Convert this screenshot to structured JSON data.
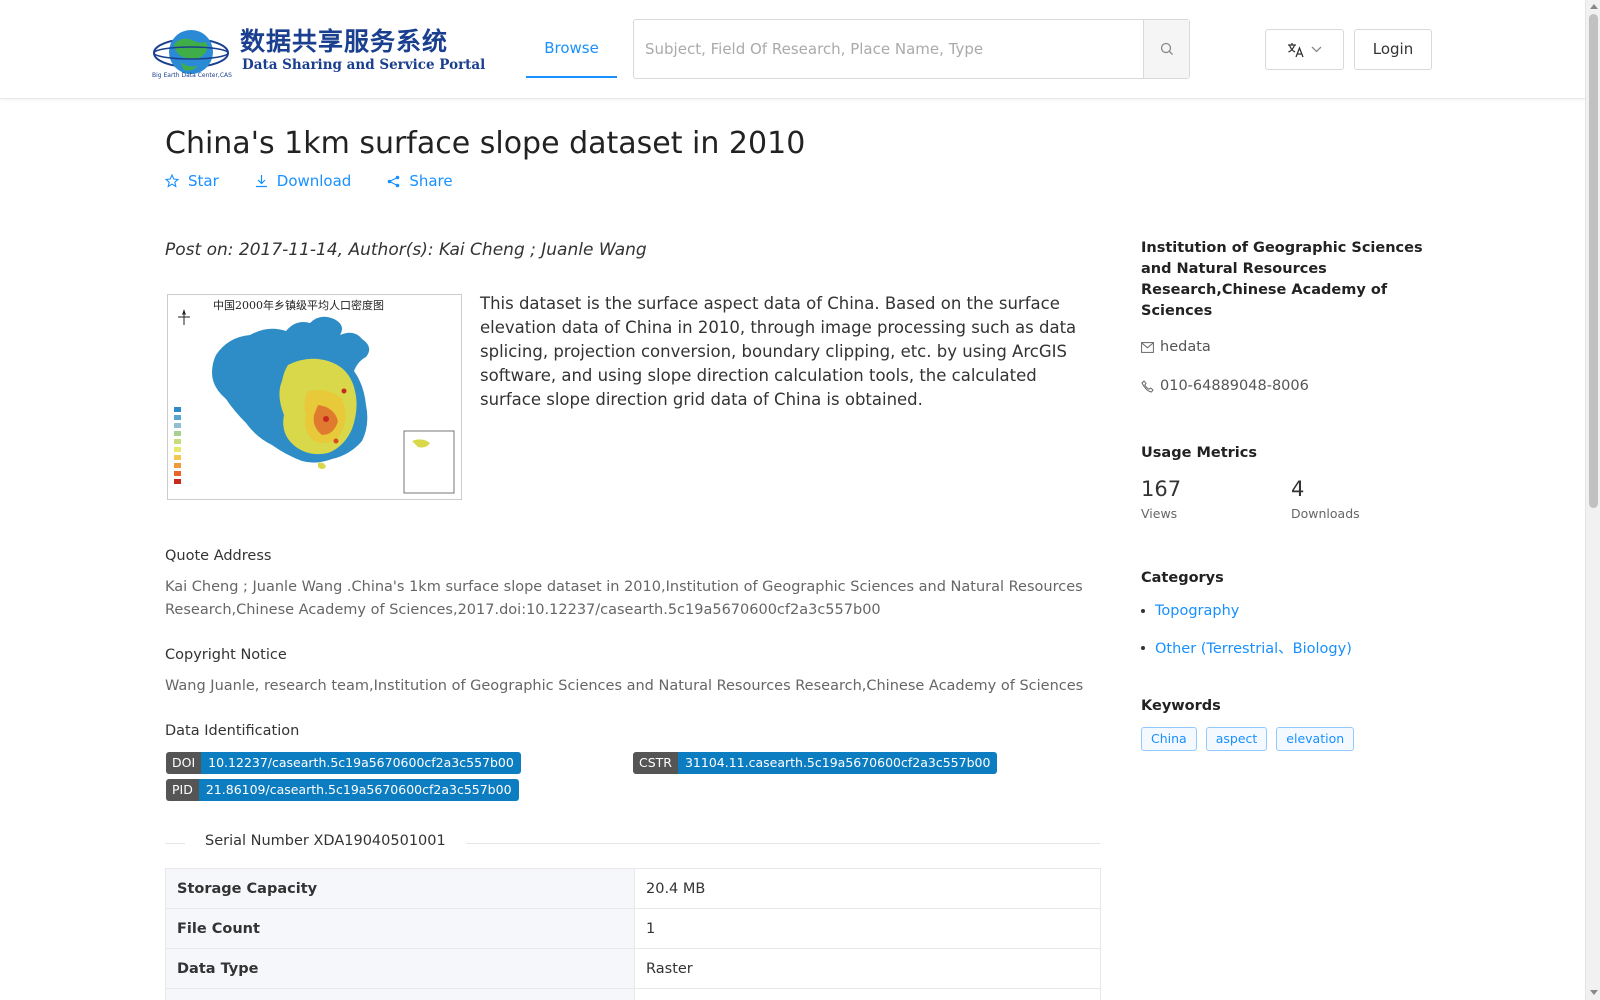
{
  "header": {
    "logo_cn": "数据共享服务系统",
    "logo_en": "Data Sharing and Service Portal",
    "logo_small": "Big Earth Data Center,CAS",
    "nav_browse": "Browse",
    "search_placeholder": "Subject, Field Of Research, Place Name, Type",
    "lang_icon": "translate-icon",
    "login": "Login"
  },
  "title": "China's 1km surface slope dataset in 2010",
  "actions": {
    "star": "Star",
    "download": "Download",
    "share": "Share"
  },
  "post_line": "Post on: 2017-11-14, Author(s): Kai Cheng ; Juanle Wang",
  "thumbnail": {
    "map_title": "中国2000年乡镇级平均人口密度图"
  },
  "description": "This dataset is the surface aspect data of China. Based on the surface elevation data of China in 2010, through image processing such as data splicing, projection conversion, boundary clipping, etc. by using ArcGIS software, and using slope direction calculation tools, the calculated surface slope direction grid data of China is obtained.",
  "quote": {
    "label": "Quote Address",
    "text": "Kai Cheng ; Juanle Wang .China's 1km surface slope dataset in 2010,Institution of Geographic Sciences and Natural Resources Research,Chinese Academy of Sciences,2017.doi:10.12237/casearth.5c19a5670600cf2a3c557b00"
  },
  "copyright": {
    "label": "Copyright Notice",
    "text": "Wang Juanle, research team,Institution of Geographic Sciences and Natural Resources Research,Chinese Academy of Sciences"
  },
  "identification": {
    "label": "Data Identification",
    "doi_key": "DOI",
    "doi_value": "10.12237/casearth.5c19a5670600cf2a3c557b00",
    "cstr_key": "CSTR",
    "cstr_value": "31104.11.casearth.5c19a5670600cf2a3c557b00",
    "pid_key": "PID",
    "pid_value": "21.86109/casearth.5c19a5670600cf2a3c557b00"
  },
  "serial": "Serial Number XDA19040501001",
  "table": [
    {
      "key": "Storage Capacity",
      "value": "20.4 MB"
    },
    {
      "key": "File Count",
      "value": "1"
    },
    {
      "key": "Data Type",
      "value": "Raster"
    }
  ],
  "sidebar": {
    "org": "Institution of Geographic Sciences and Natural Resources Research,Chinese Academy of Sciences",
    "email": "hedata",
    "phone": "010-64889048-8006",
    "usage_title": "Usage Metrics",
    "views_count": "167",
    "views_label": "Views",
    "downloads_count": "4",
    "downloads_label": "Downloads",
    "categories_title": "Categorys",
    "categories": [
      "Topography",
      "Other (Terrestrial、Biology)"
    ],
    "keywords_title": "Keywords",
    "keywords": [
      "China",
      "aspect",
      "elevation"
    ]
  },
  "colors": {
    "accent": "#1890ff",
    "ident_value_bg": "#0d7dc1",
    "ident_key_bg": "#555555"
  }
}
